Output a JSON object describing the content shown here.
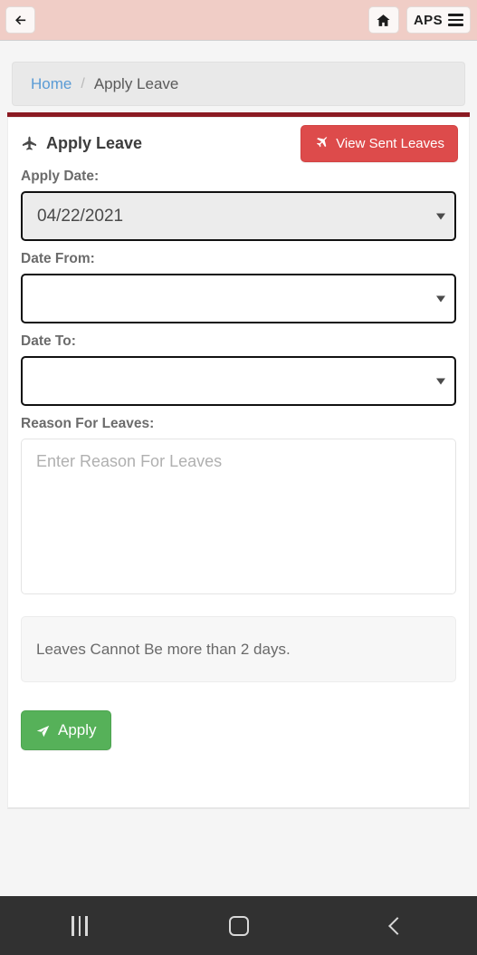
{
  "topbar": {
    "back_icon": "arrow-left-icon",
    "home_icon": "home-icon",
    "menu_label": "APS",
    "menu_icon": "hamburger-icon",
    "background_color": "#f0cdc6"
  },
  "breadcrumb": {
    "home_label": "Home",
    "separator": "/",
    "current_label": "Apply Leave",
    "link_color": "#5a9bd5"
  },
  "divider": {
    "color": "#8b1a22"
  },
  "page": {
    "title": "Apply Leave",
    "title_icon": "airplane-up-icon",
    "view_sent_button": {
      "label": "View Sent Leaves",
      "icon": "airplane-diagonal-icon",
      "color": "#dd4b4b"
    }
  },
  "form": {
    "apply_date": {
      "label": "Apply Date:",
      "value": "04/22/2021",
      "disabled": true,
      "caret_icon": "caret-down-icon"
    },
    "date_from": {
      "label": "Date From:",
      "value": "",
      "caret_icon": "caret-down-icon"
    },
    "date_to": {
      "label": "Date To:",
      "value": "",
      "caret_icon": "caret-down-icon"
    },
    "reason": {
      "label": "Reason For Leaves:",
      "placeholder": "Enter Reason For Leaves",
      "value": ""
    },
    "note": "Leaves Cannot Be more than 2 days.",
    "apply_button": {
      "label": "Apply",
      "icon": "paper-plane-icon",
      "color": "#56b159"
    }
  },
  "navbar": {
    "recents_icon": "recents-icon",
    "home_icon": "home-square-icon",
    "back_icon": "back-chevron-icon"
  }
}
